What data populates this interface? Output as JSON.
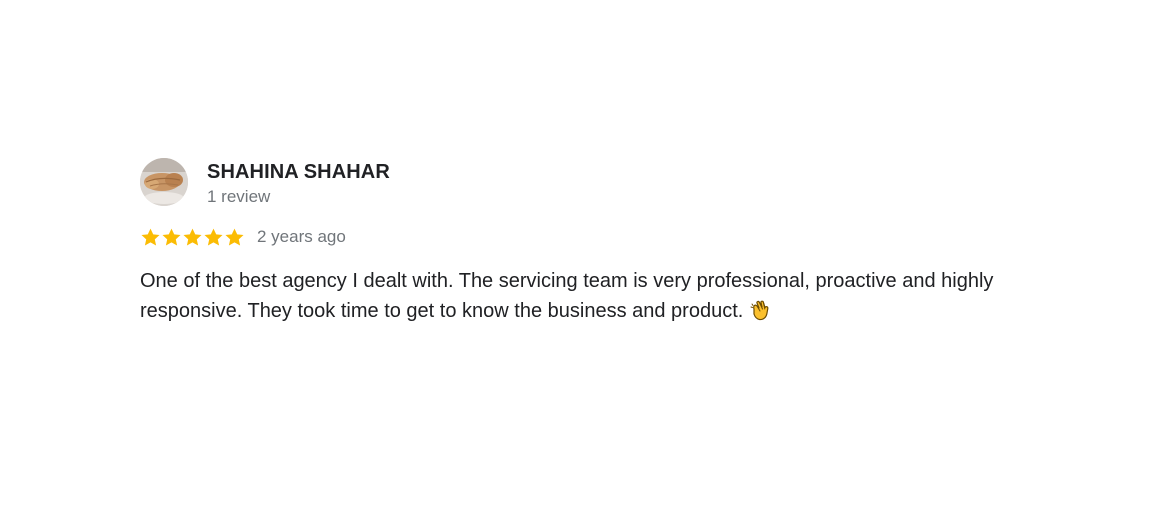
{
  "review": {
    "reviewer_name": "SHAHINA SHAHAR",
    "review_count": "1 review",
    "rating": 5,
    "rating_max": 5,
    "date": "2 years ago",
    "text": "One of the best agency I dealt with. The servicing team is very professional, proactive and highly responsive. They took time to get to know the business and product.",
    "emoji_icon": "clapping-hands-icon"
  },
  "colors": {
    "star": "#fbbc04",
    "name": "#202124",
    "secondary": "#70757a"
  }
}
